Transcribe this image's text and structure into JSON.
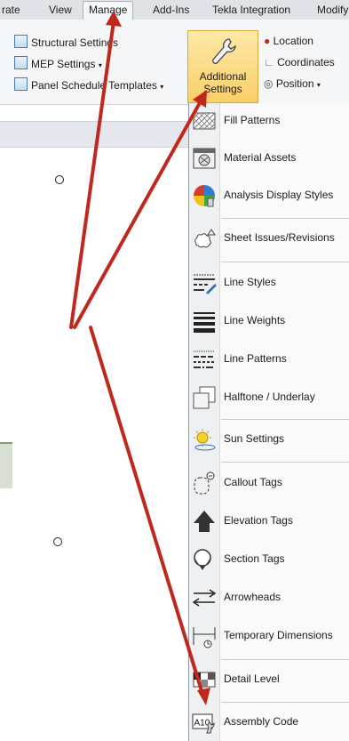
{
  "tabs": [
    "rate",
    "View",
    "Manage",
    "Add-Ins",
    "Tekla Integration",
    "Modify"
  ],
  "ribbon": {
    "structural_settings": "Structural Settings",
    "mep_settings": "MEP Settings",
    "panel_schedule_templates": "Panel Schedule Templates",
    "additional_settings_line1": "Additional",
    "additional_settings_line2": "Settings",
    "location": "Location",
    "coordinates": "Coordinates",
    "position": "Position"
  },
  "menu": {
    "items": [
      "Fill Patterns",
      "Material Assets",
      "Analysis Display Styles",
      "Sheet Issues/Revisions",
      "Line Styles",
      "Line Weights",
      "Line Patterns",
      "Halftone / Underlay",
      "Sun Settings",
      "Callout Tags",
      "Elevation Tags",
      "Section Tags",
      "Arrowheads",
      "Temporary Dimensions",
      "Detail Level",
      "Assembly Code"
    ],
    "assembly_icon_text": "A10"
  },
  "colors": {
    "annotation_arrow": "#c0271d",
    "highlight": "#f9cf6a"
  }
}
